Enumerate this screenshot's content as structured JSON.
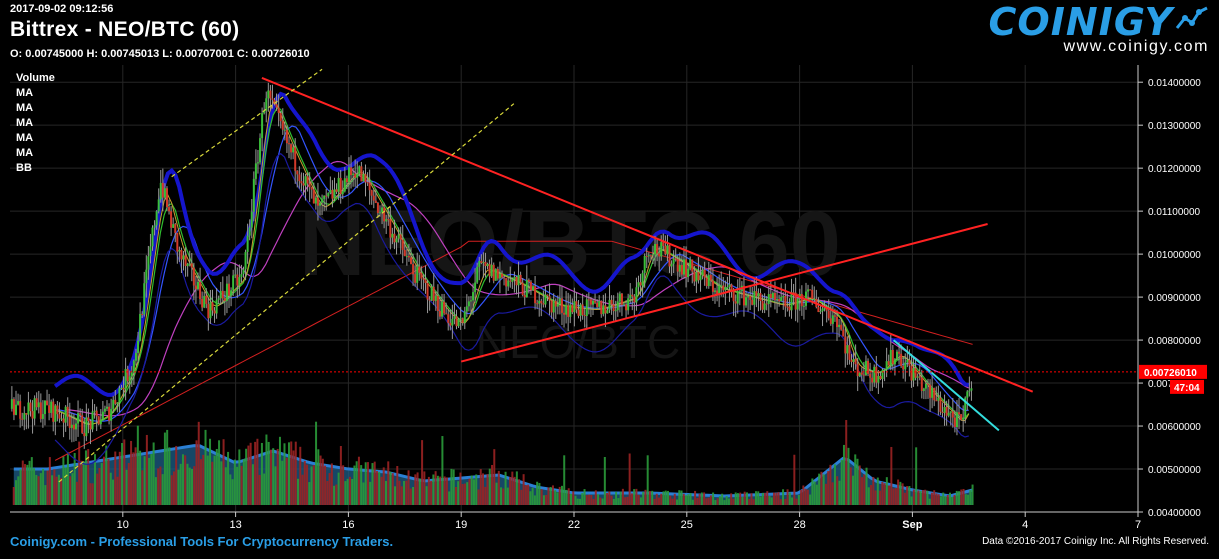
{
  "header": {
    "timestamp": "2017-09-02 09:12:56",
    "title": "Bittrex - NEO/BTC (60)",
    "ohlc": "O: 0.00745000 H: 0.00745013 L: 0.00707001 C: 0.00726010",
    "watermark_big": "NEO/BTC  60",
    "watermark_small": "NEO/BTC"
  },
  "legend": {
    "items": [
      "Volume",
      "MA",
      "MA",
      "MA",
      "MA",
      "MA",
      "BB"
    ]
  },
  "branding": {
    "logo": "COINIGY",
    "url": "www.coinigy.com",
    "accent": "#2a9ee6"
  },
  "footer": {
    "tagline": "Coinigy.com - Professional Tools For Cryptocurrency Traders.",
    "copyright": "Data ©2016-2017 Coinigy Inc. All Rights Reserved."
  },
  "chart_data": {
    "type": "candlestick",
    "x_axis": {
      "ticks": [
        "10",
        "13",
        "16",
        "19",
        "22",
        "25",
        "28",
        "Sep",
        "4",
        "7"
      ]
    },
    "y_axis": {
      "ticks": [
        "0.01400000",
        "0.01300000",
        "0.01200000",
        "0.01100000",
        "0.01000000",
        "0.00900000",
        "0.00800000",
        "0.00700000",
        "0.00600000",
        "0.00500000",
        "0.00400000"
      ],
      "ylim": [
        0.004,
        0.0144
      ]
    },
    "last_price": {
      "label": "0.00726010",
      "value": 0.0072601,
      "countdown": "47:04",
      "color": "#ff0000"
    },
    "price_path": [
      [
        8.0,
        0.0064
      ],
      [
        9.0,
        0.006
      ],
      [
        9.6,
        0.0063
      ],
      [
        10.3,
        0.0075
      ],
      [
        11.0,
        0.0117
      ],
      [
        11.5,
        0.01
      ],
      [
        12.3,
        0.0087
      ],
      [
        13.2,
        0.0095
      ],
      [
        13.8,
        0.0138
      ],
      [
        14.4,
        0.0125
      ],
      [
        15.2,
        0.011
      ],
      [
        16.2,
        0.012
      ],
      [
        17.0,
        0.0108
      ],
      [
        17.8,
        0.0095
      ],
      [
        18.6,
        0.0086
      ],
      [
        19.0,
        0.0083
      ],
      [
        19.5,
        0.0097
      ],
      [
        20.5,
        0.0093
      ],
      [
        21.5,
        0.0088
      ],
      [
        22.5,
        0.0087
      ],
      [
        23.6,
        0.009
      ],
      [
        24.0,
        0.0102
      ],
      [
        24.8,
        0.0098
      ],
      [
        25.8,
        0.0092
      ],
      [
        27.5,
        0.0088
      ],
      [
        28.2,
        0.009
      ],
      [
        29.0,
        0.0085
      ],
      [
        29.4,
        0.0074
      ],
      [
        30.0,
        0.0072
      ],
      [
        30.6,
        0.0077
      ],
      [
        31.4,
        0.0068
      ],
      [
        32.3,
        0.006
      ],
      [
        32.6,
        0.0072
      ]
    ],
    "volume_profile": [
      [
        8.0,
        0.6
      ],
      [
        9.0,
        0.7
      ],
      [
        10.0,
        0.8
      ],
      [
        11.0,
        0.9
      ],
      [
        12.0,
        1.0
      ],
      [
        13.0,
        0.7
      ],
      [
        14.0,
        0.9
      ],
      [
        15.0,
        0.7
      ],
      [
        16.0,
        0.6
      ],
      [
        17.0,
        0.55
      ],
      [
        18.0,
        0.4
      ],
      [
        19.0,
        0.45
      ],
      [
        20.0,
        0.5
      ],
      [
        21.0,
        0.3
      ],
      [
        22.0,
        0.2
      ],
      [
        24.0,
        0.2
      ],
      [
        26.0,
        0.15
      ],
      [
        28.0,
        0.2
      ],
      [
        29.2,
        0.8
      ],
      [
        30.0,
        0.4
      ],
      [
        31.0,
        0.25
      ],
      [
        32.0,
        0.15
      ],
      [
        32.6,
        0.25
      ]
    ],
    "trendlines": [
      {
        "name": "descending",
        "color": "#ff2222",
        "points": [
          [
            13.7,
            0.0141
          ],
          [
            34.2,
            0.0068
          ]
        ]
      },
      {
        "name": "ascending",
        "color": "#ff2222",
        "points": [
          [
            19.0,
            0.0075
          ],
          [
            33.0,
            0.0107
          ]
        ]
      },
      {
        "name": "short-down",
        "color": "#33dddd",
        "points": [
          [
            30.5,
            0.008
          ],
          [
            33.3,
            0.0059
          ]
        ]
      },
      {
        "name": "channel-upper",
        "color": "#d8d83a",
        "points": [
          [
            11.3,
            0.0118
          ],
          [
            15.3,
            0.0143
          ]
        ]
      },
      {
        "name": "channel-lower",
        "color": "#d8d83a",
        "points": [
          [
            8.3,
            0.0047
          ],
          [
            20.4,
            0.0135
          ]
        ]
      }
    ]
  }
}
